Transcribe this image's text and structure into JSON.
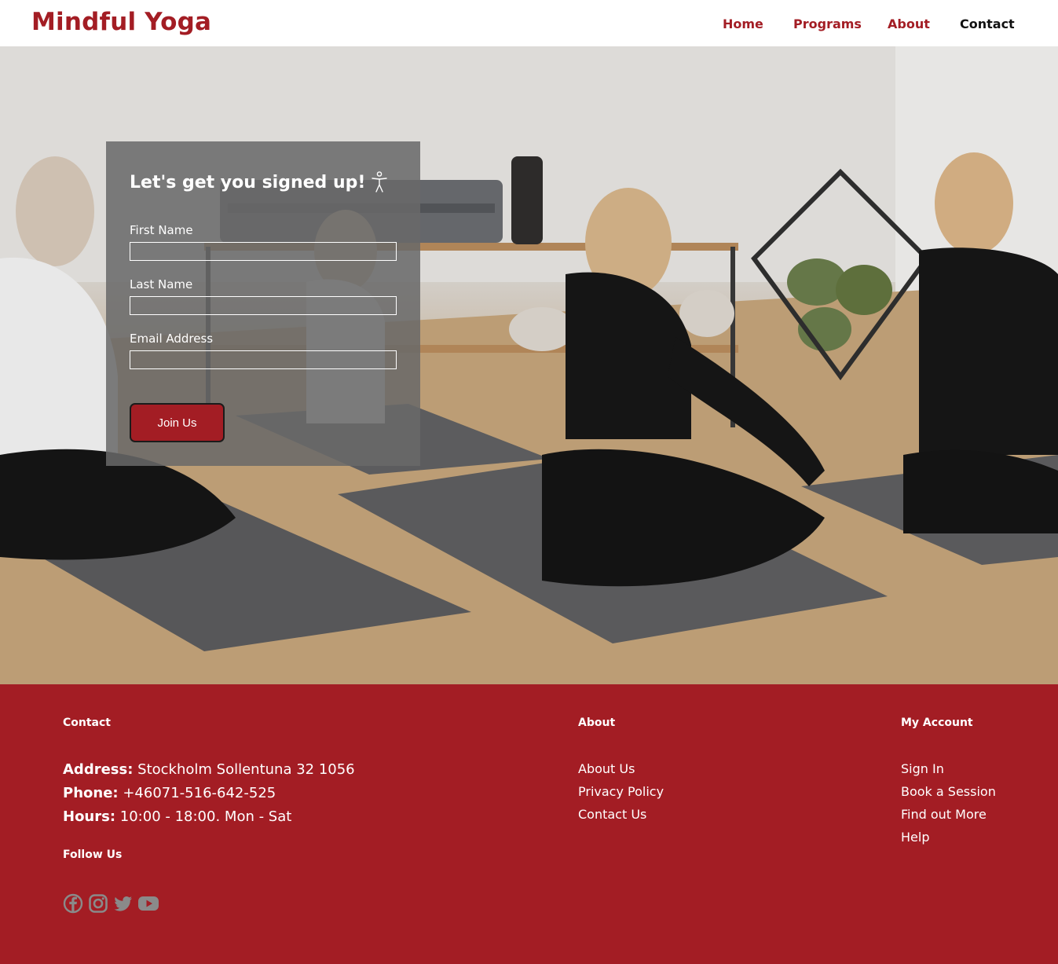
{
  "header": {
    "logo": "Mindful Yoga",
    "nav": [
      "Home",
      "Programs",
      "About",
      "Contact"
    ],
    "active_nav": "Contact"
  },
  "signup": {
    "title": "Let's get you signed up!",
    "title_icon": "accessibility-person-icon",
    "fields": [
      {
        "label": "First Name",
        "value": ""
      },
      {
        "label": "Last Name",
        "value": ""
      },
      {
        "label": "Email Address",
        "value": ""
      }
    ],
    "submit_label": "Join Us"
  },
  "footer": {
    "contact": {
      "heading": "Contact",
      "address_label": "Address:",
      "address": "Stockholm Sollentuna 32 1056",
      "phone_label": "Phone:",
      "phone": "+46071-516-642-525",
      "hours_label": "Hours:",
      "hours": "10:00 - 18:00. Mon - Sat"
    },
    "follow": {
      "heading": "Follow Us",
      "icons": [
        "facebook-icon",
        "instagram-icon",
        "twitter-icon",
        "youtube-icon"
      ]
    },
    "about": {
      "heading": "About",
      "links": [
        "About Us",
        "Privacy Policy",
        "Contact Us"
      ]
    },
    "account": {
      "heading": "My Account",
      "links": [
        "Sign In",
        "Book a Session",
        "Find out More",
        "Help"
      ]
    }
  },
  "colors": {
    "brand": "#a31d24",
    "footer_bg": "#a31d24",
    "card_bg": "rgba(105,105,105,0.86)",
    "social_icon": "#8a8a8a"
  }
}
